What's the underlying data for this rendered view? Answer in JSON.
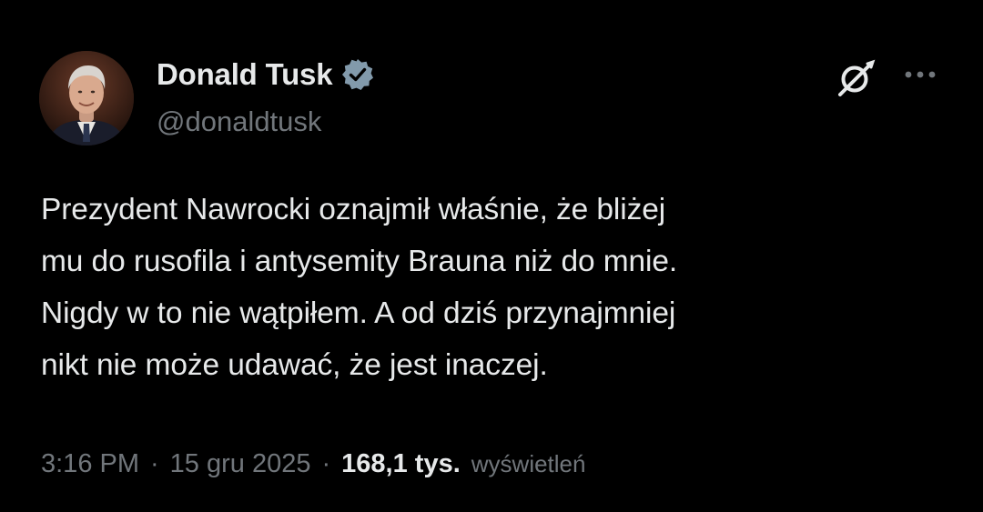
{
  "author": {
    "display_name": "Donald Tusk",
    "handle": "@donaldtusk",
    "verified_icon": "verified-badge-icon",
    "avatar_icon": "avatar"
  },
  "actions": {
    "grok_icon": "grok-icon",
    "more_icon": "more-options-icon"
  },
  "tweet": {
    "text": "Prezydent Nawrocki oznajmił właśnie, że bliżej\nmu do rusofila i antysemity Brauna niż do mnie.\nNigdy w to nie wątpiłem. A od dziś przynajmniej\nnikt nie może udawać, że jest inaczej."
  },
  "meta": {
    "time": "3:16 PM",
    "separator": "·",
    "date": "15 gru 2025",
    "views_count": "168,1 tys.",
    "views_label": "wyświetleń"
  },
  "colors": {
    "background": "#000000",
    "text_primary": "#e7e9ea",
    "text_secondary": "#71767b",
    "verified_badge": "#829aab"
  }
}
